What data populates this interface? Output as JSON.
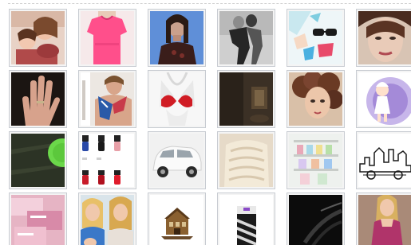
{
  "gallery": {
    "rows": [
      [
        {
          "name": "thumbnail-woman-and-child",
          "bg": "#e8d2c6"
        },
        {
          "name": "thumbnail-pink-top",
          "bg": "#f6e9ea"
        },
        {
          "name": "thumbnail-woman-blue-backdrop",
          "bg": "#5f8fd8"
        },
        {
          "name": "thumbnail-couple-black-and-white",
          "bg": "#cfcfcf"
        },
        {
          "name": "thumbnail-sunglasses-collage",
          "bg": "#eef6f8"
        },
        {
          "name": "thumbnail-face-closeup",
          "bg": "#d8c4b4"
        }
      ],
      [
        {
          "name": "thumbnail-hand",
          "bg": "#1b1512"
        },
        {
          "name": "thumbnail-man-with-scarf",
          "bg": "#ece7e2"
        },
        {
          "name": "thumbnail-red-bikini-top",
          "bg": "#f7f7f7"
        },
        {
          "name": "thumbnail-dark-interior",
          "bg": "#3b3025"
        },
        {
          "name": "thumbnail-curly-hair-woman",
          "bg": "#d9c0a8"
        },
        {
          "name": "thumbnail-purple-cartoon",
          "bg": "#c7b6ea"
        }
      ],
      [
        {
          "name": "thumbnail-dark-green-texture",
          "bg": "#2c3325"
        },
        {
          "name": "thumbnail-nail-polish-bottles",
          "bg": "#ffffff"
        },
        {
          "name": "thumbnail-white-car",
          "bg": "#f1f1f1"
        },
        {
          "name": "thumbnail-cream-knitwear",
          "bg": "#e6dac8"
        },
        {
          "name": "thumbnail-store-shelves",
          "bg": "#eef1ee"
        },
        {
          "name": "thumbnail-city-skyline-sketch",
          "bg": "#ffffff"
        }
      ],
      [
        {
          "name": "thumbnail-pink-boxes",
          "bg": "#e6b4c4"
        },
        {
          "name": "thumbnail-blonde-women",
          "bg": "#d9b98a"
        },
        {
          "name": "thumbnail-building-model",
          "bg": "#ffffff"
        },
        {
          "name": "thumbnail-striped-box",
          "bg": "#ffffff"
        },
        {
          "name": "thumbnail-black-glossy",
          "bg": "#0c0c0c"
        },
        {
          "name": "thumbnail-woman-in-dress",
          "bg": "#8b6a5a"
        }
      ]
    ]
  }
}
